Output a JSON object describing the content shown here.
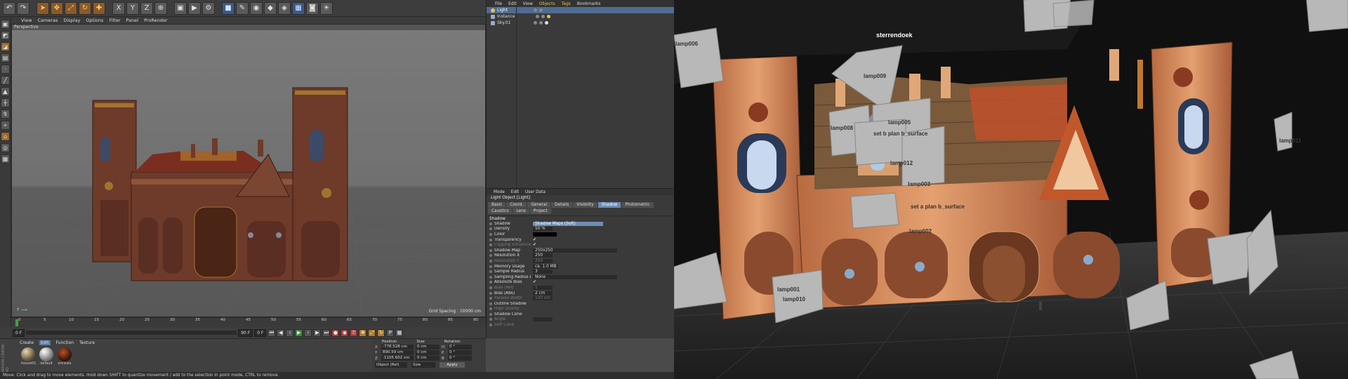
{
  "toolbar": {
    "icons": [
      "undo-icon",
      "redo-icon",
      "select-icon",
      "move-icon",
      "scale-icon",
      "rotate-icon",
      "recent-icon",
      "x-axis",
      "y-axis",
      "z-axis",
      "world-icon",
      "render-view-icon",
      "render-icon",
      "render-settings-icon",
      "cube-icon",
      "pen-icon",
      "subdivision-icon",
      "extrude-icon",
      "deformer-icon",
      "scene-icon",
      "camera-icon",
      "light-icon"
    ],
    "axis_x": "X",
    "axis_y": "Y",
    "axis_z": "Z"
  },
  "viewport": {
    "menu": [
      "View",
      "Cameras",
      "Display",
      "Options",
      "Filter",
      "Panel",
      "ProRender"
    ],
    "label": "Perspective",
    "grid_spacing": "Grid Spacing : 10000 cm"
  },
  "timeline": {
    "ticks": [
      "0",
      "5",
      "10",
      "15",
      "20",
      "25",
      "30",
      "35",
      "40",
      "45",
      "50",
      "55",
      "60",
      "65",
      "70",
      "75",
      "80",
      "85",
      "90"
    ],
    "start_field": "0 F",
    "end_field": "90 F",
    "current_field": "0 F"
  },
  "material": {
    "menu": [
      "Create",
      "Edit",
      "Function",
      "Texture"
    ],
    "active_menu": "Edit",
    "balls": [
      {
        "name": "house01",
        "color": "#6b5a44"
      },
      {
        "name": "default",
        "color": "#8a8a8a"
      },
      {
        "name": "emissio",
        "color": "#3a1a10"
      }
    ],
    "logo": "MAXON CINEMA 4D"
  },
  "coordinates": {
    "headers": [
      "Position",
      "Size",
      "Rotation"
    ],
    "rows": [
      {
        "axis": "X",
        "pos": "-778.528 cm",
        "size": "0 cm",
        "rot_axis": "H",
        "rot": "0 °"
      },
      {
        "axis": "Y",
        "pos": "890.59 cm",
        "size": "0 cm",
        "rot_axis": "P",
        "rot": "0 °"
      },
      {
        "axis": "Z",
        "pos": "-1105.602 cm",
        "size": "0 cm",
        "rot_axis": "B",
        "rot": "0 °"
      }
    ],
    "mode": "Object (Rel)",
    "size_mode": "Size",
    "apply": "Apply"
  },
  "status": "Move: Click and drag to move elements. Hold down SHIFT to quantize movement / add to the selection in point mode, CTRL to remove.",
  "object_manager": {
    "menu": [
      "File",
      "Edit",
      "View",
      "Objects",
      "Tags",
      "Bookmarks"
    ],
    "highlight": "Objects",
    "rows": [
      {
        "name": "Light",
        "type": "light",
        "selected": true
      },
      {
        "name": "Instance",
        "type": "null",
        "selected": false
      },
      {
        "name": "Sky.01",
        "type": "null",
        "selected": false
      }
    ]
  },
  "attribute_manager": {
    "menu": [
      "Mode",
      "Edit",
      "User Data"
    ],
    "title": "Light Object [Light]",
    "tabs": [
      "Basic",
      "Coord.",
      "General",
      "Details",
      "Visibility",
      "Shadow",
      "Photometric",
      "Caustics",
      "Lens",
      "Project"
    ],
    "active_tab": "Shadow",
    "section": "Shadow",
    "rows": [
      {
        "label": "Shadow",
        "value": "Shadow Maps (Soft)",
        "kind": "sel",
        "dim": false
      },
      {
        "label": "Density",
        "value": "50 %",
        "kind": "val",
        "dim": false
      },
      {
        "label": "Color",
        "value": "",
        "kind": "black",
        "dim": false
      },
      {
        "label": "Transparency",
        "value": "✔",
        "kind": "chk",
        "dim": false
      },
      {
        "label": "Clipping Influence",
        "value": "✔",
        "kind": "chk",
        "dim": true
      },
      {
        "label": "Shadow Map",
        "value": "250x250",
        "kind": "wide",
        "dim": false
      },
      {
        "label": "Resolution X",
        "value": "250",
        "kind": "val",
        "dim": false
      },
      {
        "label": "Resolution Y",
        "value": "250",
        "kind": "val",
        "dim": true
      },
      {
        "label": "Memory Usage",
        "value": "ca. 1.0 MB",
        "kind": "text",
        "dim": false
      },
      {
        "label": "Sample Radius",
        "value": "3",
        "kind": "val",
        "dim": false
      },
      {
        "label": "Sampling Radius Boost",
        "value": "None",
        "kind": "wide",
        "dim": false
      },
      {
        "label": "Absolute Bias",
        "value": "✔",
        "kind": "chk",
        "dim": false
      },
      {
        "label": "Bias (Rel)",
        "value": "1",
        "kind": "val",
        "dim": true
      },
      {
        "label": "Bias (Abs)",
        "value": "2 cm",
        "kind": "val",
        "dim": false
      },
      {
        "label": "Parallel Width",
        "value": "100 cm",
        "kind": "val",
        "dim": true
      },
      {
        "label": "Outline Shadow",
        "value": "",
        "kind": "chk",
        "dim": false
      },
      {
        "label": "High Quality",
        "value": "",
        "kind": "chk",
        "dim": true
      },
      {
        "label": "Shadow Cone",
        "value": "",
        "kind": "chk",
        "dim": false
      },
      {
        "label": "Angle",
        "value": "",
        "kind": "val",
        "dim": true
      },
      {
        "label": "Soft Cone",
        "value": "",
        "kind": "chk",
        "dim": true
      }
    ]
  },
  "photo": {
    "ceiling_label": "sterrendoek",
    "planes": [
      {
        "label": "lamp006"
      },
      {
        "label": "lamp009"
      },
      {
        "label": "lamp005"
      },
      {
        "label": "lamp008"
      },
      {
        "label": "set b plan b_surface"
      },
      {
        "label": "lamp012"
      },
      {
        "label": "lamp003"
      },
      {
        "label": "set a plan b_surface"
      },
      {
        "label": "lamp002"
      },
      {
        "label": "lamp001"
      },
      {
        "label": "lamp010"
      },
      {
        "label": "lamp004"
      },
      {
        "label": "lamp011"
      }
    ]
  },
  "colors": {
    "accent": "#6d8db5",
    "brick": "#8a4a2e",
    "highlight": "#e8c34a"
  }
}
